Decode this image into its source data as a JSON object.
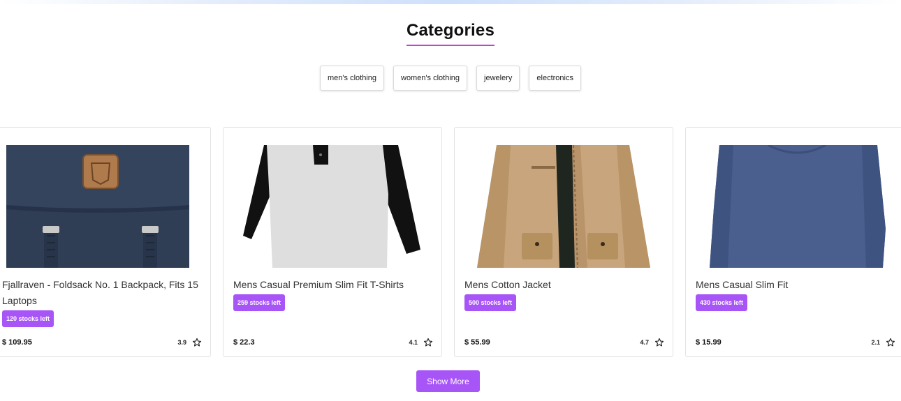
{
  "section": {
    "heading": "Categories"
  },
  "categories": [
    "men's clothing",
    "women's clothing",
    "jewelery",
    "electronics"
  ],
  "products": [
    {
      "title": "Fjallraven - Foldsack No. 1 Backpack, Fits 15 Laptops",
      "stock": "120 stocks left",
      "price": "$ 109.95",
      "rating": "3.9",
      "image": "navy-backpack"
    },
    {
      "title": "Mens Casual Premium Slim Fit T-Shirts",
      "stock": "259 stocks left",
      "price": "$ 22.3",
      "rating": "4.1",
      "image": "raglan-tshirt"
    },
    {
      "title": "Mens Cotton Jacket",
      "stock": "500 stocks left",
      "price": "$ 55.99",
      "rating": "4.7",
      "image": "khaki-jacket"
    },
    {
      "title": "Mens Casual Slim Fit",
      "stock": "430 stocks left",
      "price": "$ 15.99",
      "rating": "2.1",
      "image": "blue-longsleeve"
    }
  ],
  "actions": {
    "show_more": "Show More"
  },
  "colors": {
    "accent": "#a855f7",
    "underline": "#c63fd6"
  }
}
